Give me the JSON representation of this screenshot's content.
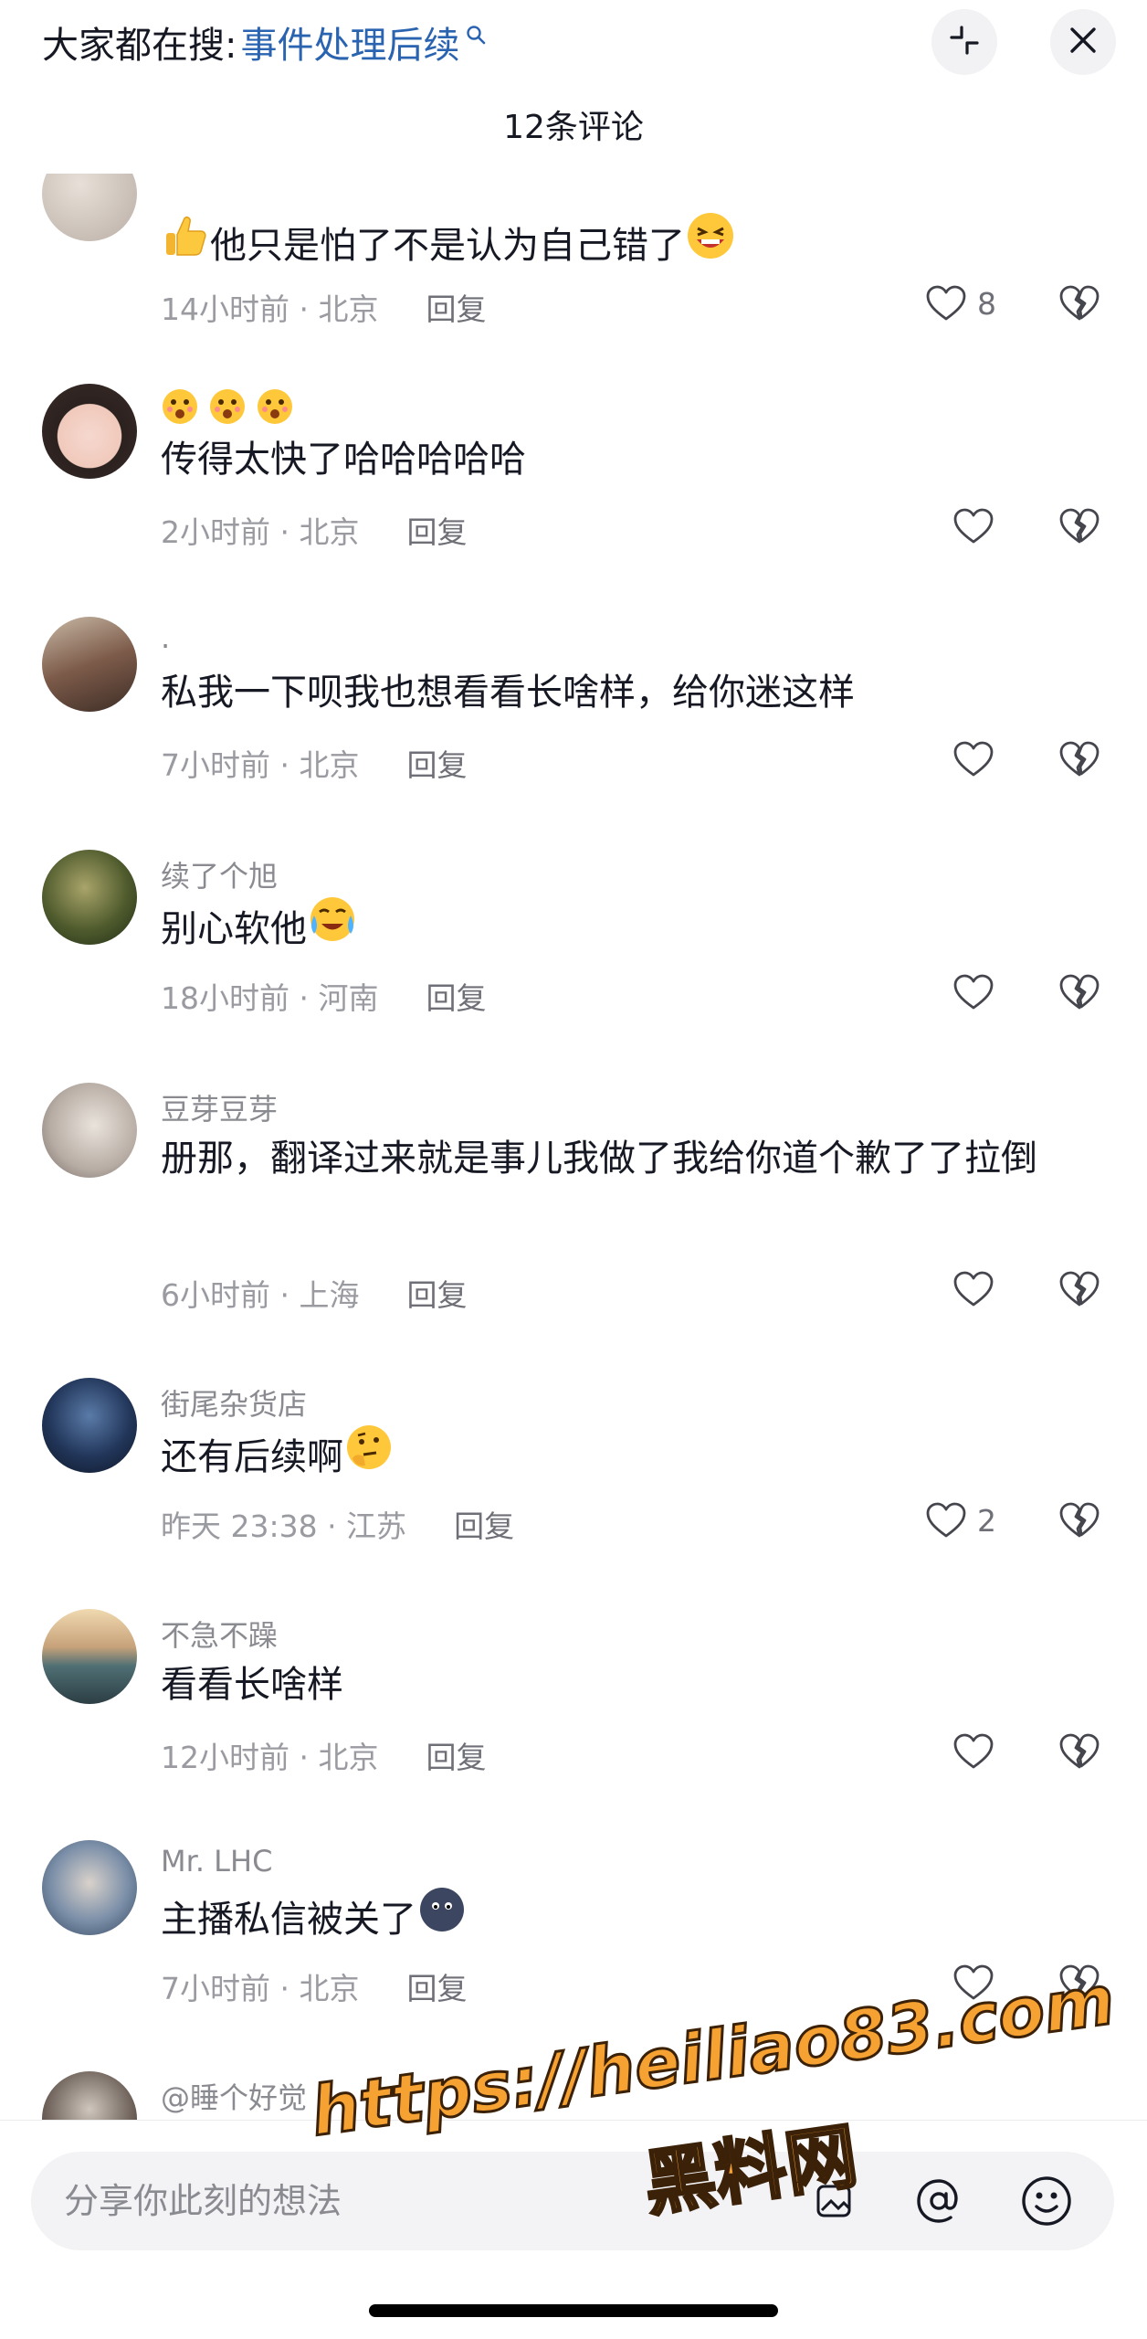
{
  "header": {
    "search_prefix": "大家都在搜:",
    "search_term": "事件处理后续",
    "comment_count": "12条评论"
  },
  "comments": [
    {
      "user": "",
      "text": "他只是怕了不是认为自己错了",
      "time": "14小时前 · 北京",
      "reply": "回复",
      "likes": "8",
      "lead_emoji": "thumbs-up-emoji",
      "trail_emoji": "laughing-emoji"
    },
    {
      "user": "",
      "text": "传得太快了哈哈哈哈哈",
      "time": "2小时前 · 北京",
      "reply": "回复",
      "likes": "",
      "name_emojis": "surprised-emoji x3"
    },
    {
      "user": ".",
      "text": "私我一下呗我也想看看长啥样，给你迷这样",
      "time": "7小时前 · 北京",
      "reply": "回复",
      "likes": ""
    },
    {
      "user": "续了个旭",
      "text": "别心软他",
      "time": "18小时前 · 河南",
      "reply": "回复",
      "likes": "",
      "trail_emoji": "crying-emoji"
    },
    {
      "user": "豆芽豆芽",
      "text": "册那，翻译过来就是事儿我做了我给你道个歉了了拉倒",
      "time": "6小时前 · 上海",
      "reply": "回复",
      "likes": ""
    },
    {
      "user": "街尾杂货店",
      "text": "还有后续啊",
      "time": "昨天 23:38 · 江苏",
      "reply": "回复",
      "likes": "2",
      "trail_emoji": "thinking-emoji"
    },
    {
      "user": "不急不躁",
      "text": "看看长啥样",
      "time": "12小时前 · 北京",
      "reply": "回复",
      "likes": ""
    },
    {
      "user": "Mr. LHC",
      "text": "主播私信被关了",
      "time": "7小时前 · 北京",
      "reply": "回复",
      "likes": "",
      "trail_emoji": "blob-emoji"
    },
    {
      "user": "@睡个好觉",
      "text": "",
      "time": "",
      "reply": "",
      "likes": ""
    }
  ],
  "input": {
    "placeholder": "分享你此刻的想法"
  },
  "watermark": {
    "url": "https://heiliao83.com",
    "name": "黑料网"
  },
  "colors": {
    "accent_link": "#2a63b0",
    "text_primary": "#161823",
    "text_secondary": "#8a8b91",
    "watermark": "#f6a233"
  }
}
